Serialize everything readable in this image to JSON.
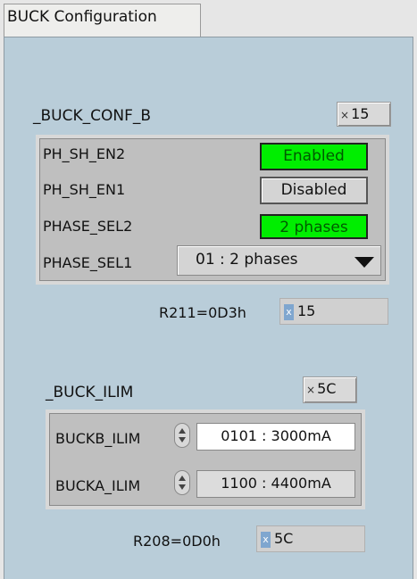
{
  "window": {
    "title": "BUCK Configuration"
  },
  "buck_conf_b": {
    "title": "_BUCK_CONF_B",
    "hex_value": "15",
    "rows": [
      {
        "label": "PH_SH_EN2",
        "value": "Enabled"
      },
      {
        "label": "PH_SH_EN1",
        "value": "Disabled"
      },
      {
        "label": "PHASE_SEL2",
        "value": "2 phases"
      },
      {
        "label": "PHASE_SEL1",
        "value": "01 : 2 phases"
      }
    ],
    "register_label": "R211=0D3h",
    "register_value": "15"
  },
  "buck_ilim": {
    "title": "_BUCK_ILIM",
    "hex_value": "5C",
    "rows": [
      {
        "label": "BUCKB_ILIM",
        "value": "0101 : 3000mA"
      },
      {
        "label": "BUCKA_ILIM",
        "value": "1100 : 4400mA"
      }
    ],
    "register_label": "R208=0D0h",
    "register_value": "5C"
  },
  "ui": {
    "x_glyph": "×",
    "reg_x_glyph": "x"
  },
  "colors": {
    "enabled_green": "#00ee00",
    "frame_blue": "#b9cdd9"
  }
}
